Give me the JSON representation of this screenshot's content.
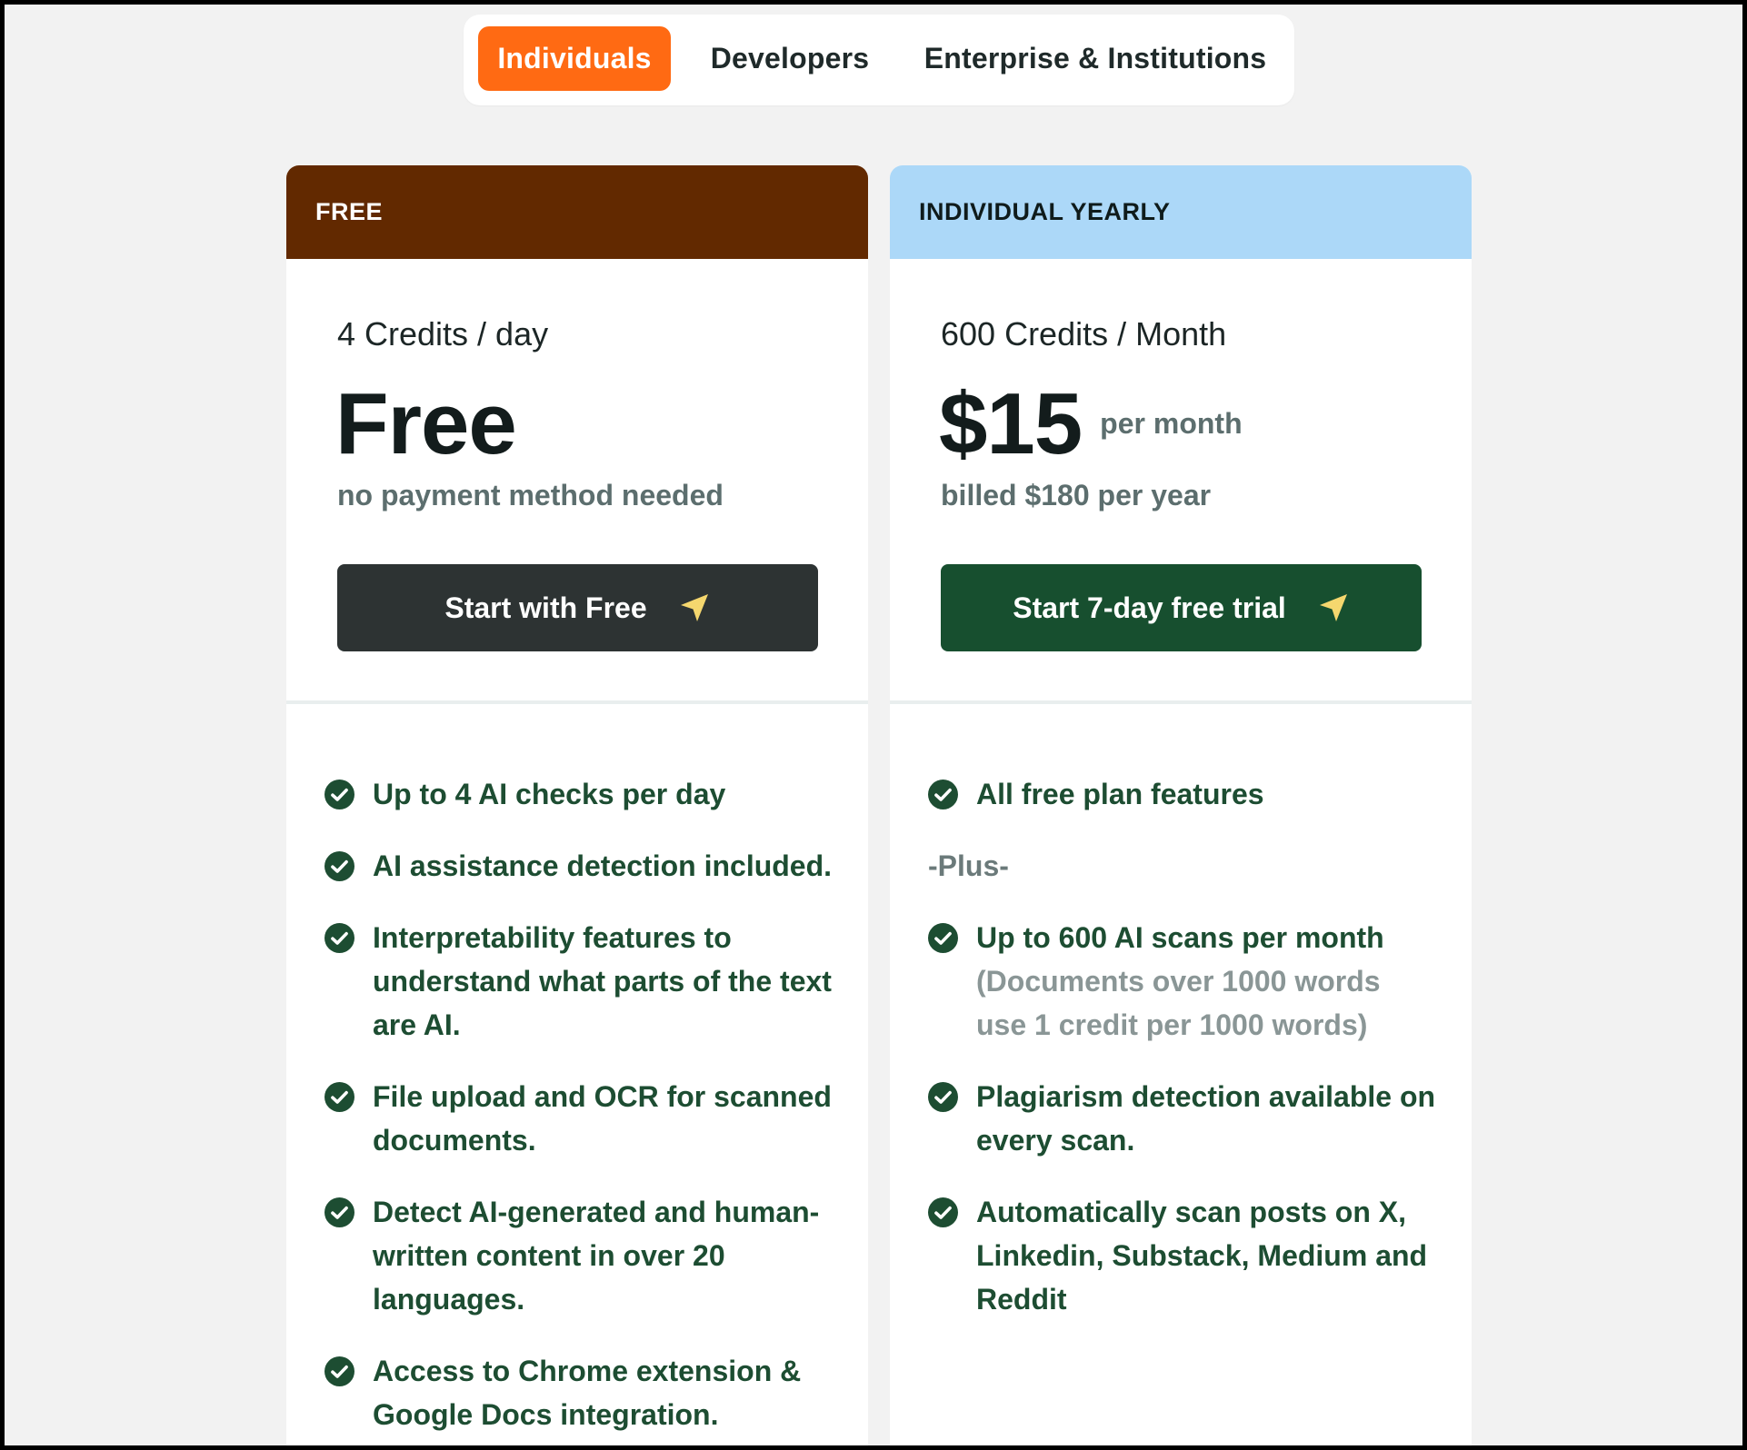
{
  "tabs": [
    {
      "label": "Individuals",
      "active": true
    },
    {
      "label": "Developers",
      "active": false
    },
    {
      "label": "Enterprise & Institutions",
      "active": false
    }
  ],
  "plans": {
    "free": {
      "header": "FREE",
      "credits": "4 Credits / day",
      "price": "Free",
      "note": "no payment method needed",
      "cta": "Start with Free",
      "features": [
        "Up to 4 AI checks per day",
        "AI assistance detection included.",
        "Interpretability features to understand what parts of the text are AI.",
        "File upload and OCR for scanned documents.",
        "Detect AI-generated and human-written content in over 20 languages.",
        "Access to Chrome extension & Google Docs integration."
      ]
    },
    "yearly": {
      "header": "INDIVIDUAL YEARLY",
      "credits": "600 Credits / Month",
      "price": "$15",
      "per": "per month",
      "note": "billed $180 per year",
      "cta": "Start 7-day free trial",
      "feature_first": "All free plan features",
      "plus": "-Plus-",
      "feature_scans": "Up to 600 AI scans per month",
      "feature_scans_note": "(Documents over 1000 words use 1 credit per 1000 words)",
      "feature_plagiarism": "Plagiarism detection available on every scan.",
      "feature_social": "Automatically scan posts on X, Linkedin, Substack, Medium and Reddit"
    }
  },
  "colors": {
    "accent_orange": "#ff6a13",
    "free_header": "#622900",
    "yearly_header": "#acd8f8",
    "free_cta": "#2d3333",
    "yearly_cta": "#174f2f",
    "feature_text": "#1d4d32",
    "arrow": "#f5d76e"
  },
  "icons": {
    "check": "check-circle-icon",
    "cta_arrow": "send-arrow-icon"
  }
}
